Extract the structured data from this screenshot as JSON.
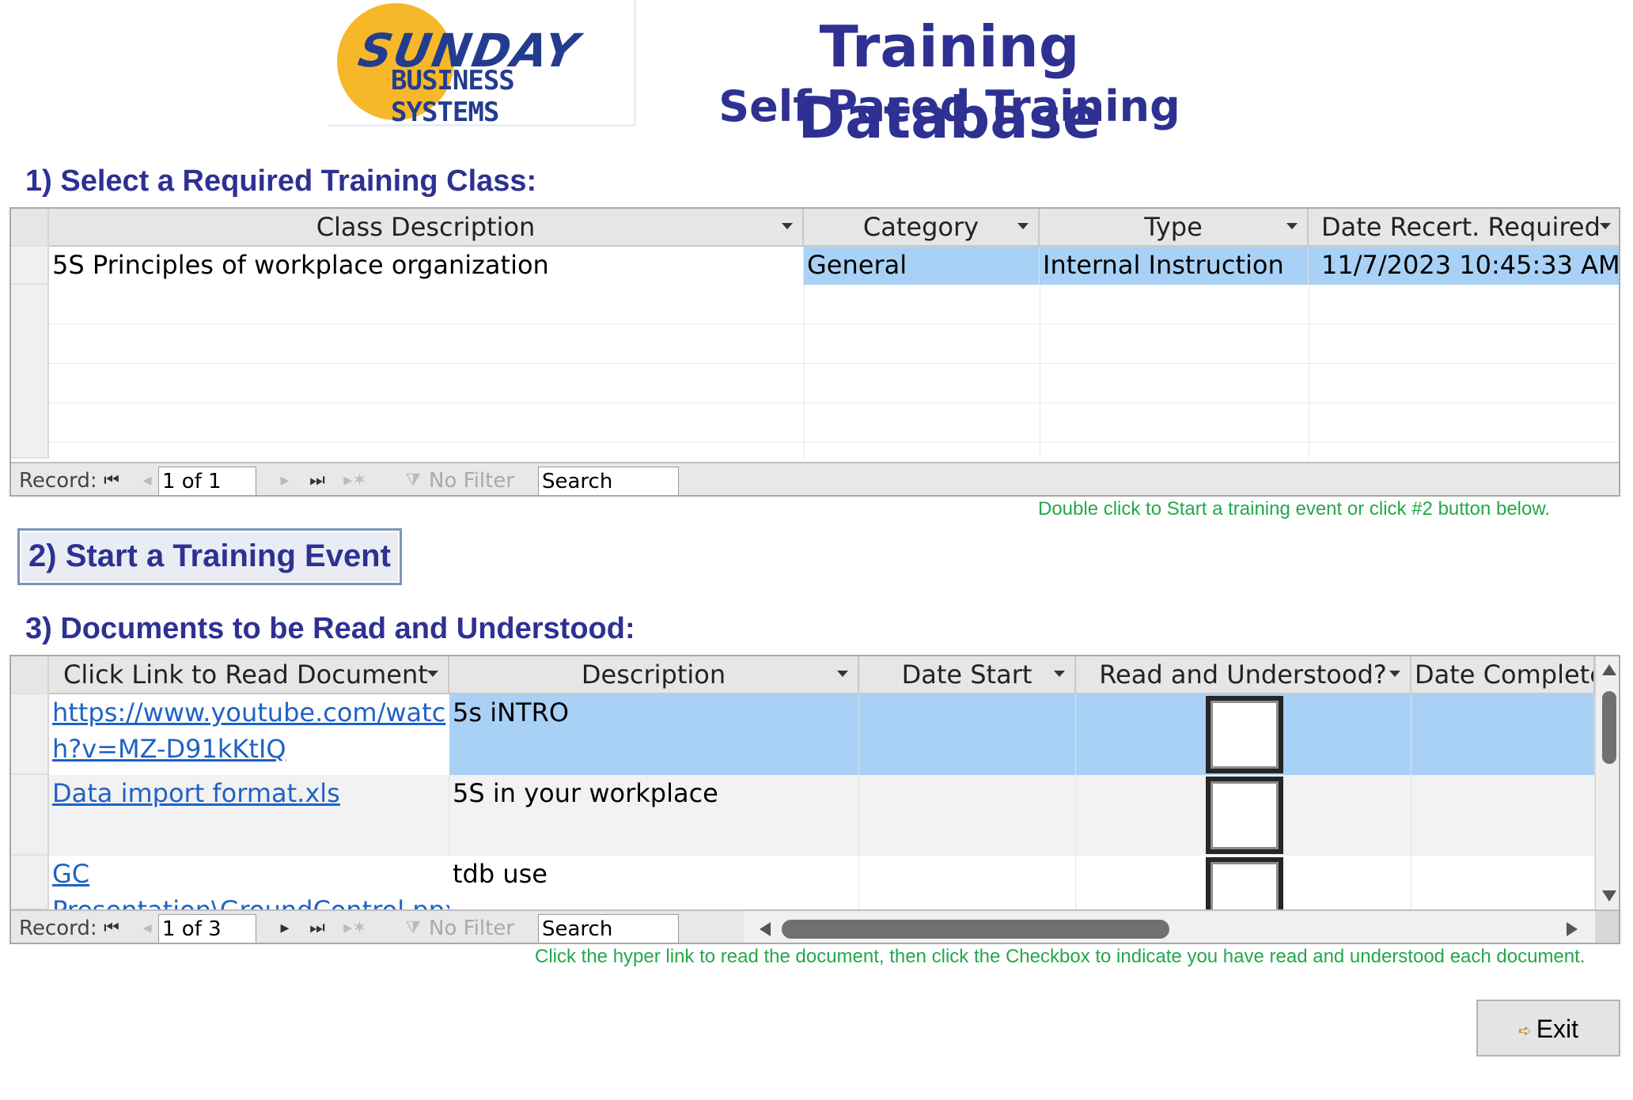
{
  "logo": {
    "line1": "SUNDAY",
    "line2": "BUSINESS SYSTEMS"
  },
  "header": {
    "title": "Training Database",
    "subtitle": "Self Paced Training"
  },
  "section1": {
    "heading": "1) Select a Required Training Class:",
    "columns": [
      "Class Description",
      "Category",
      "Type",
      "Date Recert. Required"
    ],
    "rows": [
      {
        "class_description": "5S Principles of workplace organization",
        "category": "General",
        "type": "Internal Instruction",
        "date_recert": "11/7/2023 10:45:33 AM"
      }
    ],
    "nav": {
      "record_label": "Record:",
      "position": "1 of 1",
      "no_filter": "No Filter",
      "search": "Search"
    },
    "hint": "Double click to Start a training event or click #2 button below."
  },
  "start_button": {
    "label": "2) Start a Training Event"
  },
  "section3": {
    "heading": "3) Documents to be Read and Understood:",
    "columns": [
      "Click Link to Read Document",
      "Description",
      "Date Start",
      "Read and Understood?",
      "Date Complete"
    ],
    "rows": [
      {
        "link_line1": "https://www.youtube.com/watc",
        "link_line2": "h?v=MZ-D91kKtIQ",
        "description": "5s iNTRO",
        "date_start": "",
        "read": false,
        "date_complete": ""
      },
      {
        "link_line1": "Data import format.xls",
        "link_line2": "",
        "description": "5S in your workplace",
        "date_start": "",
        "read": false,
        "date_complete": ""
      },
      {
        "link_line1": "GC ",
        "link_line2": "Presentation\\GroundControl.ppx",
        "description": "tdb use",
        "date_start": "",
        "read": false,
        "date_complete": ""
      }
    ],
    "nav": {
      "record_label": "Record:",
      "position": "1 of 3",
      "no_filter": "No Filter",
      "search": "Search"
    },
    "hint": "Click the hyper link to read the document, then click the Checkbox to indicate you have read and understood each document."
  },
  "exit_button": {
    "label": "Exit"
  },
  "colors": {
    "heading": "#2e3192",
    "hint": "#22a84a",
    "selection": "#a9d1f5",
    "link": "#1f62c4"
  },
  "icons": [
    "first-record-icon",
    "prev-record-icon",
    "next-record-icon",
    "last-record-icon",
    "new-record-icon",
    "filter-icon",
    "exit-door-icon"
  ]
}
